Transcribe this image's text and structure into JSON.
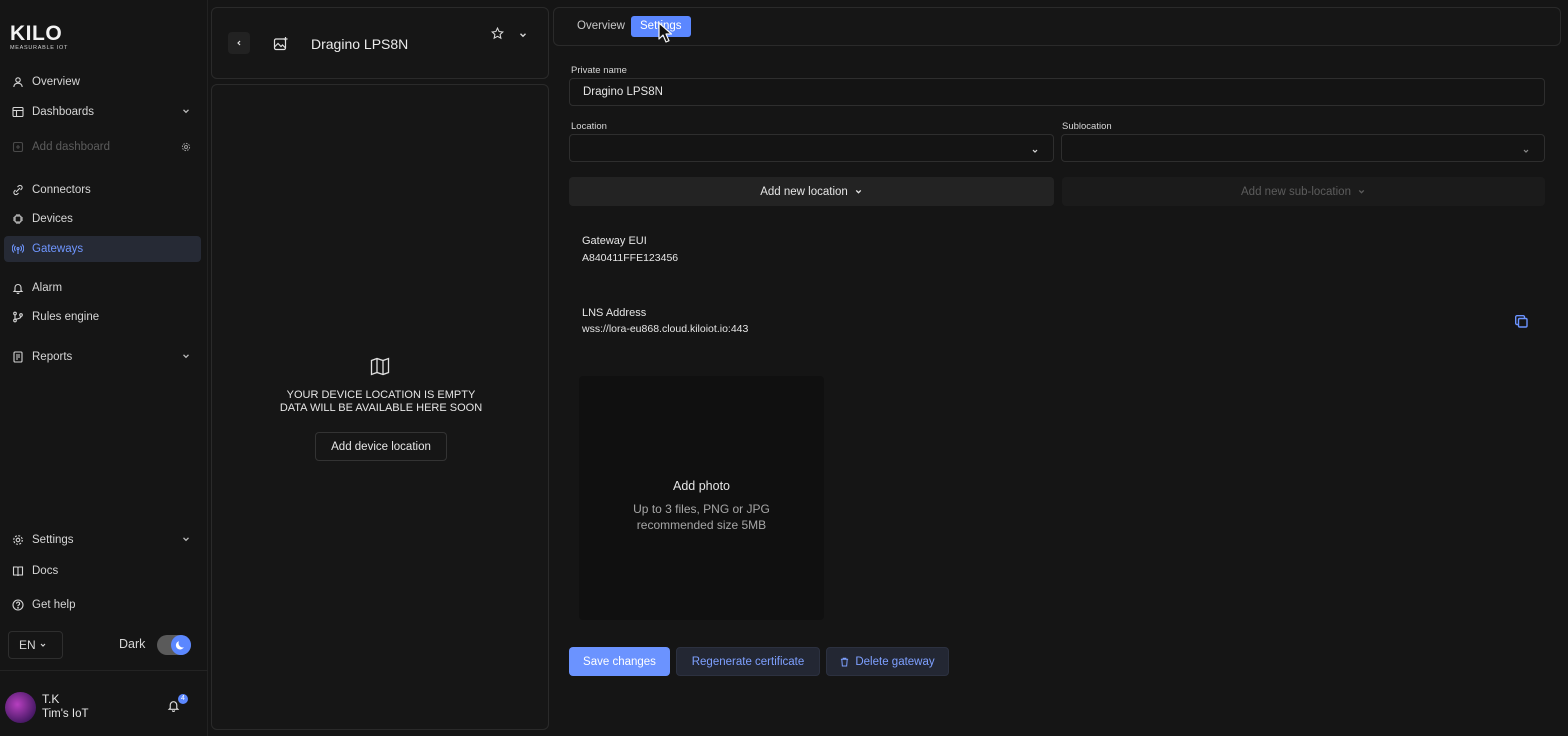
{
  "brand": {
    "logo_text": "KILO",
    "tagline": "MEASURABLE IOT"
  },
  "sidebar": {
    "items": [
      {
        "label": "Overview",
        "icon": "user-icon"
      },
      {
        "label": "Dashboards",
        "icon": "dashboard-icon",
        "expandable": true
      },
      {
        "label": "Add dashboard",
        "icon": "add-icon",
        "disabled": true
      },
      {
        "label": "Connectors",
        "icon": "connector-icon"
      },
      {
        "label": "Devices",
        "icon": "chip-icon"
      },
      {
        "label": "Gateways",
        "icon": "antenna-icon",
        "active": true
      },
      {
        "label": "Alarm",
        "icon": "bell-icon"
      },
      {
        "label": "Rules engine",
        "icon": "branch-icon"
      },
      {
        "label": "Reports",
        "icon": "report-icon",
        "expandable": true
      }
    ],
    "bottom_items": [
      {
        "label": "Settings",
        "icon": "gear-icon",
        "expandable": true
      },
      {
        "label": "Docs",
        "icon": "book-icon"
      },
      {
        "label": "Get help",
        "icon": "help-icon"
      }
    ],
    "language": "EN",
    "theme_label": "Dark",
    "theme_dark_enabled": true,
    "user": {
      "initials_name": "T.K",
      "org": "Tim's IoT",
      "notifications": "4"
    }
  },
  "device": {
    "title": "Dragino LPS8N",
    "location_empty_line1": "YOUR DEVICE LOCATION IS EMPTY",
    "location_empty_line2": "DATA WILL BE AVAILABLE HERE SOON",
    "add_location_button": "Add device location"
  },
  "tabs": [
    {
      "label": "Overview",
      "active": false
    },
    {
      "label": "Settings",
      "active": true
    }
  ],
  "settings": {
    "private_name_label": "Private name",
    "private_name_value": "Dragino LPS8N",
    "location_label": "Location",
    "location_value": "",
    "sublocation_label": "Sublocation",
    "sublocation_value": "",
    "add_location_button": "Add new location",
    "add_sublocation_button": "Add new sub-location",
    "gateway_eui_label": "Gateway EUI",
    "gateway_eui_value": "A840411FFE123456",
    "lns_label": "LNS Address",
    "lns_value": "wss://lora-eu868.cloud.kiloiot.io:443",
    "photo_title": "Add photo",
    "photo_hint_line1": "Up to 3 files, PNG or JPG",
    "photo_hint_line2": "recommended size 5MB",
    "save_button": "Save changes",
    "regenerate_button": "Regenerate certificate",
    "delete_button": "Delete gateway"
  },
  "colors": {
    "accent": "#5b87ff",
    "background": "#151515",
    "active_nav_bg": "#262a35"
  }
}
